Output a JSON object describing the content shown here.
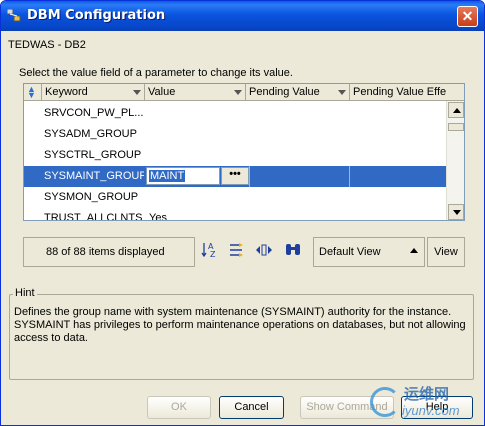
{
  "window": {
    "title": "DBM Configuration",
    "close_glyph": "✕"
  },
  "connection_label": "TEDWAS - DB2",
  "instruction": "Select the value field of a parameter to change its value.",
  "grid": {
    "columns": [
      "Keyword",
      "Value",
      "Pending Value",
      "Pending Value Effe"
    ],
    "rows": [
      {
        "keyword": "SRVCON_PW_PL...",
        "value": ""
      },
      {
        "keyword": "SYSADM_GROUP",
        "value": ""
      },
      {
        "keyword": "SYSCTRL_GROUP",
        "value": ""
      },
      {
        "keyword": "SYSMAINT_GROUP",
        "value": "MAINT",
        "selected": true,
        "ellipsis": "•••"
      },
      {
        "keyword": "SYSMON_GROUP",
        "value": ""
      },
      {
        "keyword": "TRUST_ALLCLNTS",
        "value": "Yes"
      }
    ]
  },
  "toolbar": {
    "count_text": "88 of 88 items displayed",
    "icons": [
      "sort-az-icon",
      "filter-icon",
      "columns-icon",
      "find-icon"
    ],
    "view_label": "Default View",
    "view_button": "View"
  },
  "hint": {
    "legend": "Hint",
    "line1": "Defines the group name with system maintenance (SYSMAINT) authority for the instance.",
    "line2": "SYSMAINT has privileges to perform maintenance operations on databases, but not allowing",
    "line3": "access to data."
  },
  "buttons": {
    "ok": "OK",
    "cancel": "Cancel",
    "show_command": "Show Command",
    "help": "Help"
  },
  "watermark": {
    "line1": "运维网",
    "line2": "iyunv.com"
  }
}
